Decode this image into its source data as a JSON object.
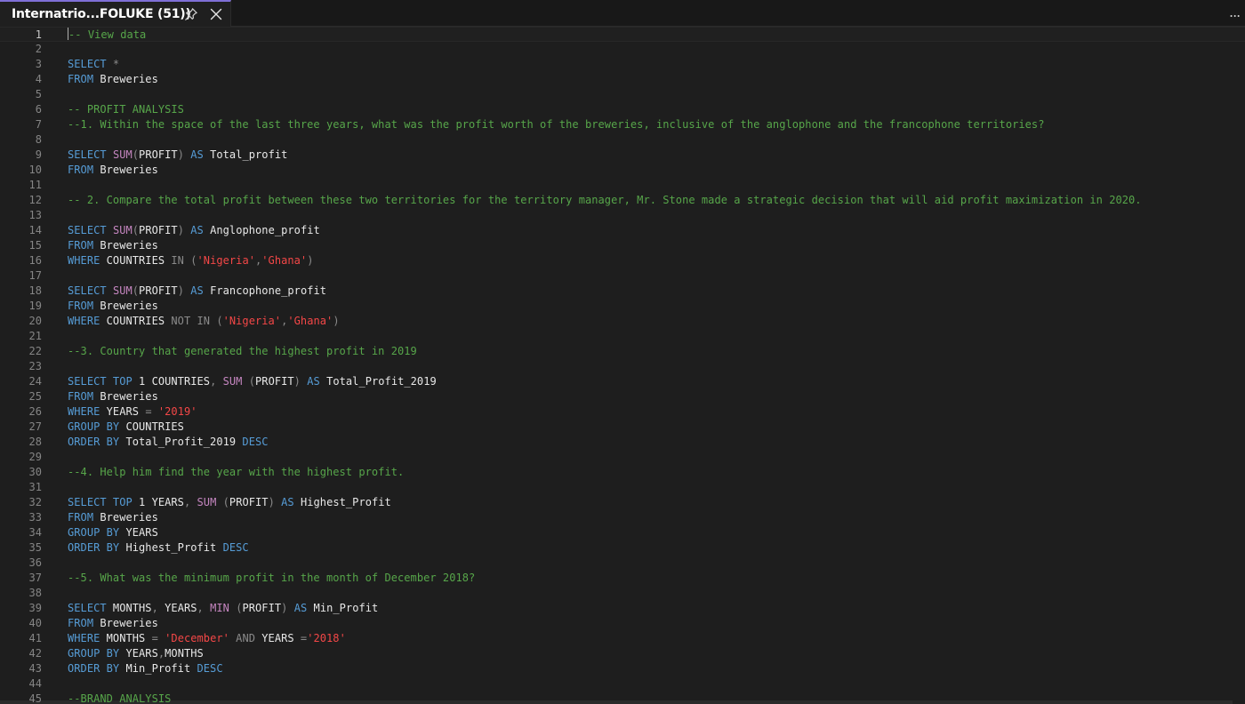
{
  "tab": {
    "title": "Internatrio...FOLUKE (51))",
    "pin_icon": "pin-icon",
    "close_icon": "close-icon",
    "more_label": "..."
  },
  "editor": {
    "current_line": 1,
    "lines": [
      {
        "n": "1",
        "t": [
          {
            "c": "cm",
            "s": "-- View data"
          }
        ]
      },
      {
        "n": "2",
        "t": []
      },
      {
        "n": "3",
        "t": [
          {
            "c": "kw",
            "s": "SELECT"
          },
          {
            "c": "op",
            "s": " *"
          }
        ]
      },
      {
        "n": "4",
        "t": [
          {
            "c": "kw",
            "s": "FROM"
          },
          {
            "c": "id",
            "s": " Breweries"
          }
        ]
      },
      {
        "n": "5",
        "t": []
      },
      {
        "n": "6",
        "t": [
          {
            "c": "cm",
            "s": "-- PROFIT ANALYSIS"
          }
        ]
      },
      {
        "n": "7",
        "t": [
          {
            "c": "cm",
            "s": "--1. Within the space of the last three years, what was the profit worth of the breweries, inclusive of the anglophone and the francophone territories?"
          }
        ]
      },
      {
        "n": "8",
        "t": []
      },
      {
        "n": "9",
        "t": [
          {
            "c": "kw",
            "s": "SELECT "
          },
          {
            "c": "fn",
            "s": "SUM"
          },
          {
            "c": "op",
            "s": "("
          },
          {
            "c": "id",
            "s": "PROFIT"
          },
          {
            "c": "op",
            "s": ") "
          },
          {
            "c": "kw",
            "s": "AS"
          },
          {
            "c": "id",
            "s": " Total_profit"
          }
        ]
      },
      {
        "n": "10",
        "t": [
          {
            "c": "kw",
            "s": "FROM"
          },
          {
            "c": "id",
            "s": " Breweries"
          }
        ]
      },
      {
        "n": "11",
        "t": []
      },
      {
        "n": "12",
        "t": [
          {
            "c": "cm",
            "s": "-- 2. Compare the total profit between these two territories for the territory manager, Mr. Stone made a strategic decision that will aid profit maximization in 2020."
          }
        ]
      },
      {
        "n": "13",
        "t": []
      },
      {
        "n": "14",
        "t": [
          {
            "c": "kw",
            "s": "SELECT "
          },
          {
            "c": "fn",
            "s": "SUM"
          },
          {
            "c": "op",
            "s": "("
          },
          {
            "c": "id",
            "s": "PROFIT"
          },
          {
            "c": "op",
            "s": ") "
          },
          {
            "c": "kw",
            "s": "AS"
          },
          {
            "c": "id",
            "s": " Anglophone_profit"
          }
        ]
      },
      {
        "n": "15",
        "t": [
          {
            "c": "kw",
            "s": "FROM"
          },
          {
            "c": "id",
            "s": " Breweries"
          }
        ]
      },
      {
        "n": "16",
        "t": [
          {
            "c": "kw",
            "s": "WHERE"
          },
          {
            "c": "id",
            "s": " COUNTRIES "
          },
          {
            "c": "op",
            "s": "IN ("
          },
          {
            "c": "str",
            "s": "'Nigeria'"
          },
          {
            "c": "op",
            "s": ","
          },
          {
            "c": "str",
            "s": "'Ghana'"
          },
          {
            "c": "op",
            "s": ")"
          }
        ]
      },
      {
        "n": "17",
        "t": []
      },
      {
        "n": "18",
        "t": [
          {
            "c": "kw",
            "s": "SELECT "
          },
          {
            "c": "fn",
            "s": "SUM"
          },
          {
            "c": "op",
            "s": "("
          },
          {
            "c": "id",
            "s": "PROFIT"
          },
          {
            "c": "op",
            "s": ") "
          },
          {
            "c": "kw",
            "s": "AS"
          },
          {
            "c": "id",
            "s": " Francophone_profit"
          }
        ]
      },
      {
        "n": "19",
        "t": [
          {
            "c": "kw",
            "s": "FROM"
          },
          {
            "c": "id",
            "s": " Breweries"
          }
        ]
      },
      {
        "n": "20",
        "t": [
          {
            "c": "kw",
            "s": "WHERE"
          },
          {
            "c": "id",
            "s": " COUNTRIES "
          },
          {
            "c": "op",
            "s": "NOT IN ("
          },
          {
            "c": "str",
            "s": "'Nigeria'"
          },
          {
            "c": "op",
            "s": ","
          },
          {
            "c": "str",
            "s": "'Ghana'"
          },
          {
            "c": "op",
            "s": ")"
          }
        ]
      },
      {
        "n": "21",
        "t": []
      },
      {
        "n": "22",
        "t": [
          {
            "c": "cm",
            "s": "--3. Country that generated the highest profit in 2019"
          }
        ]
      },
      {
        "n": "23",
        "t": []
      },
      {
        "n": "24",
        "t": [
          {
            "c": "kw",
            "s": "SELECT TOP "
          },
          {
            "c": "id",
            "s": "1 COUNTRIES"
          },
          {
            "c": "op",
            "s": ", "
          },
          {
            "c": "fn",
            "s": "SUM"
          },
          {
            "c": "op",
            "s": " ("
          },
          {
            "c": "id",
            "s": "PROFIT"
          },
          {
            "c": "op",
            "s": ") "
          },
          {
            "c": "kw",
            "s": "AS"
          },
          {
            "c": "id",
            "s": " Total_Profit_2019"
          }
        ]
      },
      {
        "n": "25",
        "t": [
          {
            "c": "kw",
            "s": "FROM"
          },
          {
            "c": "id",
            "s": " Breweries"
          }
        ]
      },
      {
        "n": "26",
        "t": [
          {
            "c": "kw",
            "s": "WHERE"
          },
          {
            "c": "id",
            "s": " YEARS "
          },
          {
            "c": "op",
            "s": "= "
          },
          {
            "c": "str",
            "s": "'2019'"
          }
        ]
      },
      {
        "n": "27",
        "t": [
          {
            "c": "kw",
            "s": "GROUP BY"
          },
          {
            "c": "id",
            "s": " COUNTRIES"
          }
        ]
      },
      {
        "n": "28",
        "t": [
          {
            "c": "kw",
            "s": "ORDER BY"
          },
          {
            "c": "id",
            "s": " Total_Profit_2019 "
          },
          {
            "c": "kw",
            "s": "DESC"
          }
        ]
      },
      {
        "n": "29",
        "t": []
      },
      {
        "n": "30",
        "t": [
          {
            "c": "cm",
            "s": "--4. Help him find the year with the highest profit."
          }
        ]
      },
      {
        "n": "31",
        "t": []
      },
      {
        "n": "32",
        "t": [
          {
            "c": "kw",
            "s": "SELECT TOP "
          },
          {
            "c": "id",
            "s": "1 YEARS"
          },
          {
            "c": "op",
            "s": ", "
          },
          {
            "c": "fn",
            "s": "SUM"
          },
          {
            "c": "op",
            "s": " ("
          },
          {
            "c": "id",
            "s": "PROFIT"
          },
          {
            "c": "op",
            "s": ") "
          },
          {
            "c": "kw",
            "s": "AS"
          },
          {
            "c": "id",
            "s": " Highest_Profit"
          }
        ]
      },
      {
        "n": "33",
        "t": [
          {
            "c": "kw",
            "s": "FROM"
          },
          {
            "c": "id",
            "s": " Breweries"
          }
        ]
      },
      {
        "n": "34",
        "t": [
          {
            "c": "kw",
            "s": "GROUP BY"
          },
          {
            "c": "id",
            "s": " YEARS"
          }
        ]
      },
      {
        "n": "35",
        "t": [
          {
            "c": "kw",
            "s": "ORDER BY"
          },
          {
            "c": "id",
            "s": " Highest_Profit "
          },
          {
            "c": "kw",
            "s": "DESC"
          }
        ]
      },
      {
        "n": "36",
        "t": []
      },
      {
        "n": "37",
        "t": [
          {
            "c": "cm",
            "s": "--5. What was the minimum profit in the month of December 2018?"
          }
        ]
      },
      {
        "n": "38",
        "t": []
      },
      {
        "n": "39",
        "t": [
          {
            "c": "kw",
            "s": "SELECT"
          },
          {
            "c": "id",
            "s": " MONTHS"
          },
          {
            "c": "op",
            "s": ", "
          },
          {
            "c": "id",
            "s": "YEARS"
          },
          {
            "c": "op",
            "s": ", "
          },
          {
            "c": "fn",
            "s": "MIN"
          },
          {
            "c": "op",
            "s": " ("
          },
          {
            "c": "id",
            "s": "PROFIT"
          },
          {
            "c": "op",
            "s": ") "
          },
          {
            "c": "kw",
            "s": "AS"
          },
          {
            "c": "id",
            "s": " Min_Profit"
          }
        ]
      },
      {
        "n": "40",
        "t": [
          {
            "c": "kw",
            "s": "FROM"
          },
          {
            "c": "id",
            "s": " Breweries"
          }
        ]
      },
      {
        "n": "41",
        "t": [
          {
            "c": "kw",
            "s": "WHERE"
          },
          {
            "c": "id",
            "s": " MONTHS "
          },
          {
            "c": "op",
            "s": "= "
          },
          {
            "c": "str",
            "s": "'December'"
          },
          {
            "c": "op",
            "s": " AND "
          },
          {
            "c": "id",
            "s": "YEARS "
          },
          {
            "c": "op",
            "s": "="
          },
          {
            "c": "str",
            "s": "'2018'"
          }
        ]
      },
      {
        "n": "42",
        "t": [
          {
            "c": "kw",
            "s": "GROUP BY"
          },
          {
            "c": "id",
            "s": " YEARS"
          },
          {
            "c": "op",
            "s": ","
          },
          {
            "c": "id",
            "s": "MONTHS"
          }
        ]
      },
      {
        "n": "43",
        "t": [
          {
            "c": "kw",
            "s": "ORDER BY"
          },
          {
            "c": "id",
            "s": " Min_Profit "
          },
          {
            "c": "kw",
            "s": "DESC"
          }
        ]
      },
      {
        "n": "44",
        "t": []
      },
      {
        "n": "45",
        "t": [
          {
            "c": "cm",
            "s": "--BRAND ANALYSIS"
          }
        ]
      }
    ]
  },
  "colors": {
    "background": "#1e1e1e",
    "keyword": "#569cd6",
    "function": "#c586c0",
    "string": "#f44747",
    "comment": "#57a64a",
    "identifier": "#e8e8e8",
    "accent": "#7f6fd6"
  }
}
